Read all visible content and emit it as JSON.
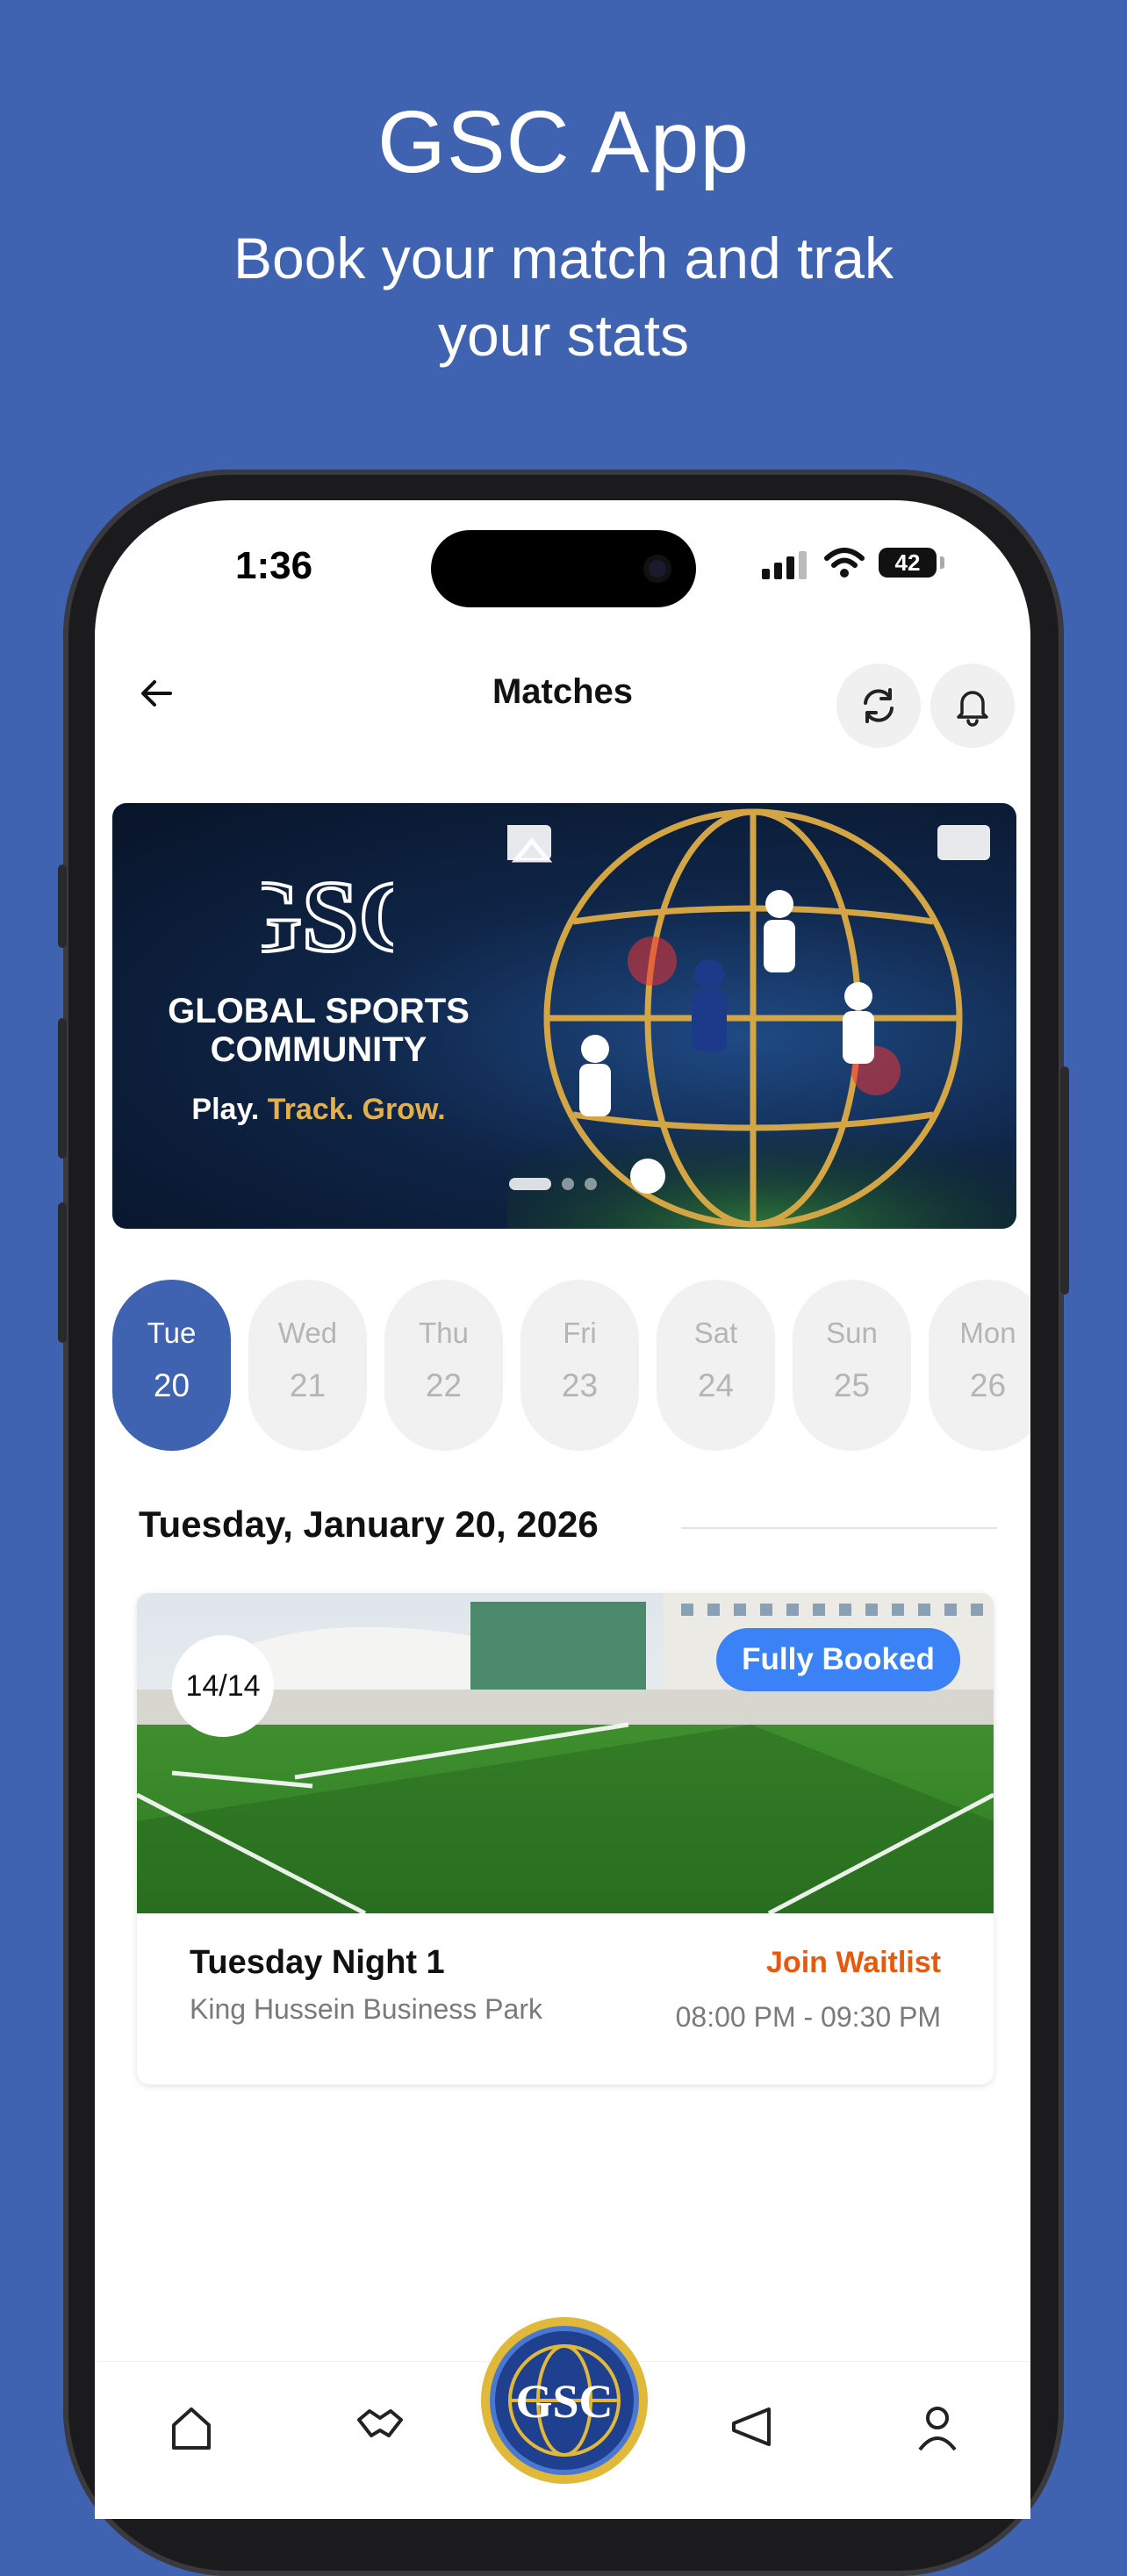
{
  "promo": {
    "title": "GSC App",
    "subtitle": "Book your match and trak your stats"
  },
  "status_bar": {
    "time": "1:36",
    "battery": "42"
  },
  "header": {
    "title": "Matches",
    "back_icon": "arrow-left-icon",
    "refresh_icon": "refresh-icon",
    "bell_icon": "bell-icon"
  },
  "banner": {
    "logo_text": "GSC",
    "title_line1": "GLOBAL SPORTS",
    "title_line2": "COMMUNITY",
    "tagline_play": "Play.",
    "tagline_rest": "Track. Grow."
  },
  "days": [
    {
      "name": "Tue",
      "num": "20",
      "active": true
    },
    {
      "name": "Wed",
      "num": "21",
      "active": false
    },
    {
      "name": "Thu",
      "num": "22",
      "active": false
    },
    {
      "name": "Fri",
      "num": "23",
      "active": false
    },
    {
      "name": "Sat",
      "num": "24",
      "active": false
    },
    {
      "name": "Sun",
      "num": "25",
      "active": false
    },
    {
      "name": "Mon",
      "num": "26",
      "active": false
    }
  ],
  "date_heading": "Tuesday, January 20, 2026",
  "match": {
    "count": "14/14",
    "status": "Fully Booked",
    "name": "Tuesday Night 1",
    "venue": "King Hussein Business Park",
    "action": "Join Waitlist",
    "time": "08:00 PM - 09:30 PM"
  },
  "bottom_nav": {
    "center_logo": "GSC",
    "icons": [
      "home-icon",
      "handshake-icon",
      "megaphone-icon",
      "profile-icon"
    ]
  },
  "colors": {
    "brand_blue": "#3f63b1",
    "badge_blue": "#3b82f6",
    "waitlist_orange": "#e8590c",
    "gold": "#e3b04b"
  }
}
